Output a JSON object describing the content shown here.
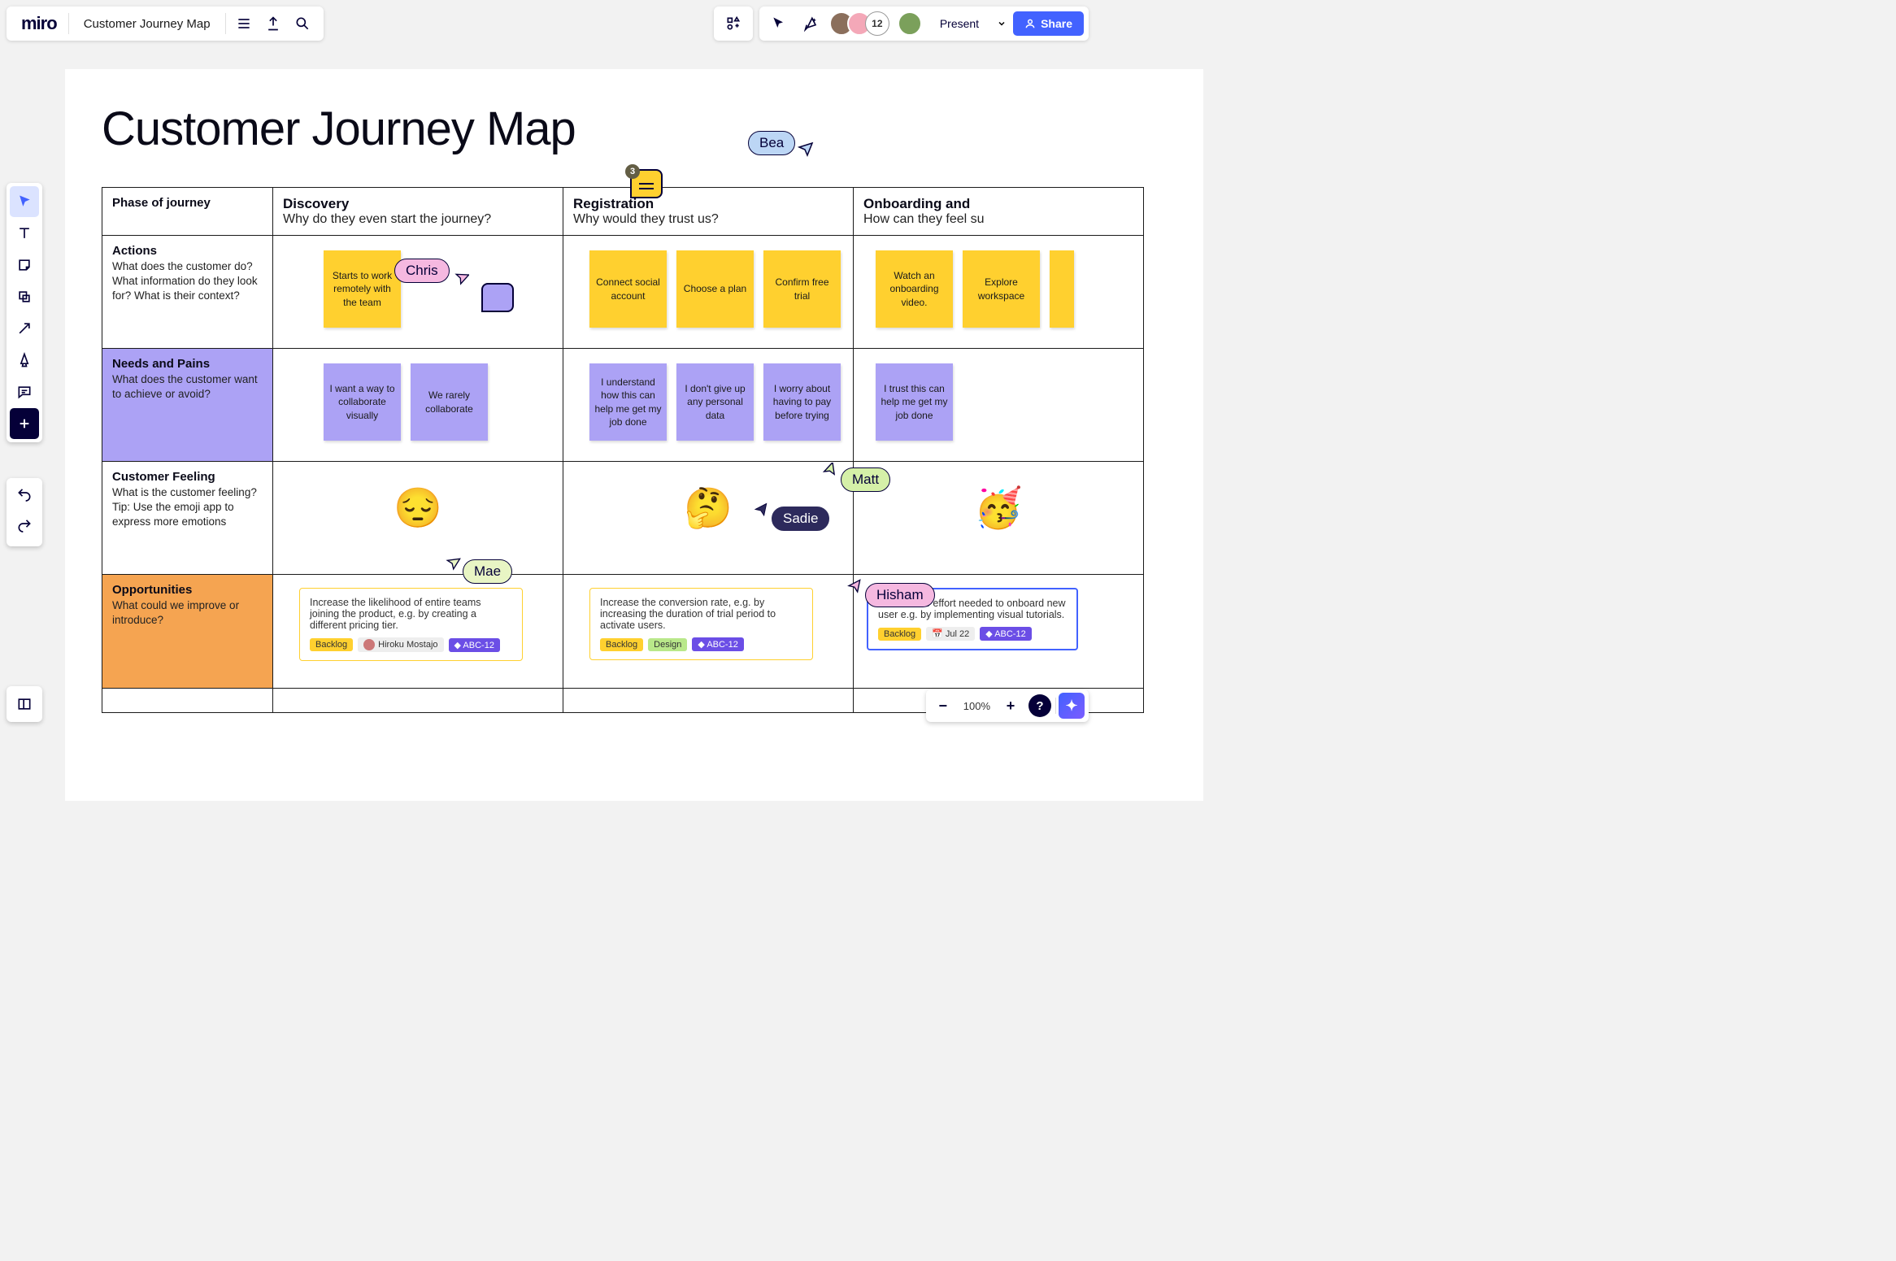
{
  "app": {
    "logo": "miro",
    "board_title": "Customer Journey Map"
  },
  "topbar_right": {
    "user_count": "12",
    "present_label": "Present",
    "share_label": "Share"
  },
  "canvas": {
    "heading": "Customer Journey Map",
    "phase_header": "Phase of journey",
    "columns": [
      {
        "title": "Discovery",
        "sub": "Why do they even start the journey?"
      },
      {
        "title": "Registration",
        "sub": "Why would they trust us?"
      },
      {
        "title": "Onboarding and",
        "sub": "How can they feel su"
      }
    ],
    "rows": {
      "actions": {
        "title": "Actions",
        "sub": "What does the customer do? What information do they look for? What is their context?",
        "cells": [
          [
            "Starts to work remotely with the team"
          ],
          [
            "Connect social account",
            "Choose a plan",
            "Confirm free trial"
          ],
          [
            "Watch an onboarding video.",
            "Explore workspace"
          ]
        ]
      },
      "needs": {
        "title": "Needs and Pains",
        "sub": "What does the customer want to achieve or avoid?",
        "cells": [
          [
            "I want a way to collaborate visually",
            "We rarely collaborate"
          ],
          [
            "I understand how this can help me get my job done",
            "I don't give up any personal data",
            "I worry about having to pay before trying"
          ],
          [
            "I trust this can help me get my job done"
          ]
        ]
      },
      "feeling": {
        "title": "Customer Feeling",
        "sub": "What is the customer feeling? Tip: Use the emoji app to express more emotions",
        "emojis": [
          "😔",
          "🤔",
          "🥳"
        ]
      },
      "opp": {
        "title": "Opportunities",
        "sub": "What could we improve or introduce?",
        "cards": [
          {
            "text": "Increase the likelihood of entire teams joining the product, e.g. by creating a different pricing tier.",
            "tags": [
              {
                "t": "Backlog",
                "c": "backlog"
              },
              {
                "t": "Hiroku Mostajo",
                "c": "person"
              },
              {
                "t": "ABC-12",
                "c": "ticket"
              }
            ]
          },
          {
            "text": "Increase the conversion rate, e.g. by increasing the duration of trial period to activate users.",
            "tags": [
              {
                "t": "Backlog",
                "c": "backlog"
              },
              {
                "t": "Design",
                "c": "design"
              },
              {
                "t": "ABC-12",
                "c": "ticket"
              }
            ]
          },
          {
            "text": "Reduce the effort needed to onboard new user e.g. by implementing visual tutorials.",
            "tags": [
              {
                "t": "Backlog",
                "c": "backlog"
              },
              {
                "t": "Jul 22",
                "c": "date"
              },
              {
                "t": "ABC-12",
                "c": "ticket"
              }
            ]
          }
        ]
      }
    },
    "comment_count": "3"
  },
  "cursors": {
    "bea": "Bea",
    "chris": "Chris",
    "matt": "Matt",
    "sadie": "Sadie",
    "mae": "Mae",
    "hisham": "Hisham"
  },
  "zoom": {
    "level": "100%"
  }
}
